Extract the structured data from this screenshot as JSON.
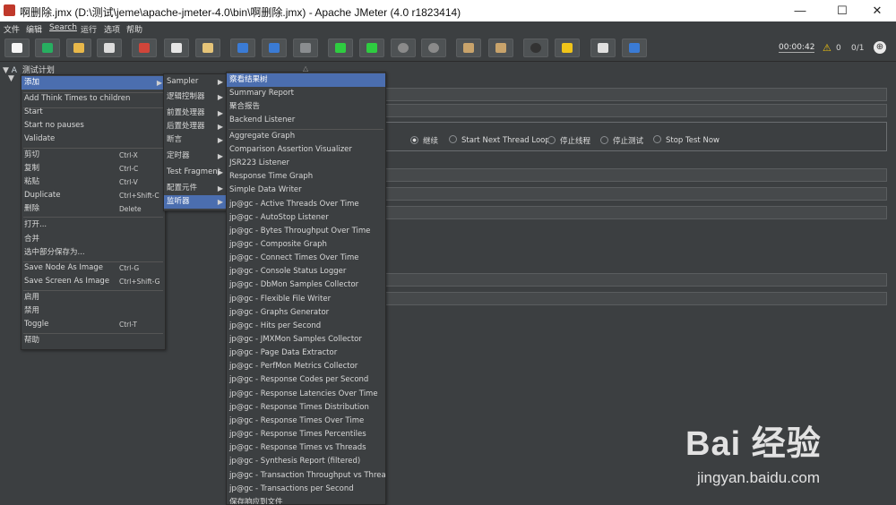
{
  "window": {
    "title": "啊删除.jmx (D:\\测试\\jeme\\apache-jmeter-4.0\\bin\\啊删除.jmx) - Apache JMeter (4.0 r1823414)",
    "minimize": "—",
    "maximize": "☐",
    "close": "✕"
  },
  "menubar": [
    "文件",
    "编辑",
    "Search",
    "运行",
    "选项",
    "帮助"
  ],
  "toolbar": {
    "icons": [
      "new-icon",
      "templates-icon",
      "open-icon",
      "save-icon",
      "cut-icon",
      "copy-icon",
      "paste-icon",
      "expand-icon",
      "collapse-icon",
      "toggle-icon",
      "start-icon",
      "start-no-pauses-icon",
      "stop-icon",
      "shutdown-icon",
      "clear-icon",
      "clear-all-icon",
      "search-icon",
      "reset-search-icon",
      "function-helper-icon",
      "help-icon"
    ],
    "timer": "00:00:42",
    "warning_count": "0",
    "threads": "0/1"
  },
  "tree": {
    "root": "测试计划"
  },
  "thread_group": {
    "on_error_options": [
      "继续",
      "Start Next Thread Loop",
      "停止线程",
      "停止测试",
      "Stop Test Now"
    ],
    "selected": "继续"
  },
  "context_menu": {
    "items": [
      {
        "label": "添加",
        "shortcut": "",
        "submenu": true,
        "selected": true
      },
      {
        "label": "Add Think Times to children",
        "shortcut": ""
      },
      {
        "label": "Start",
        "shortcut": ""
      },
      {
        "label": "Start no pauses",
        "shortcut": ""
      },
      {
        "label": "Validate",
        "shortcut": ""
      },
      {
        "label": "剪切",
        "shortcut": "Ctrl-X"
      },
      {
        "label": "复制",
        "shortcut": "Ctrl-C"
      },
      {
        "label": "粘贴",
        "shortcut": "Ctrl-V"
      },
      {
        "label": "Duplicate",
        "shortcut": "Ctrl+Shift-C"
      },
      {
        "label": "删除",
        "shortcut": "Delete"
      },
      {
        "label": "打开...",
        "shortcut": ""
      },
      {
        "label": "合并",
        "shortcut": ""
      },
      {
        "label": "选中部分保存为...",
        "shortcut": ""
      },
      {
        "label": "Save Node As Image",
        "shortcut": "Ctrl-G"
      },
      {
        "label": "Save Screen As Image",
        "shortcut": "Ctrl+Shift-G"
      },
      {
        "label": "启用",
        "shortcut": ""
      },
      {
        "label": "禁用",
        "shortcut": ""
      },
      {
        "label": "Toggle",
        "shortcut": "Ctrl-T"
      },
      {
        "label": "帮助",
        "shortcut": ""
      }
    ]
  },
  "add_submenu": {
    "items": [
      {
        "label": "Sampler"
      },
      {
        "label": "逻辑控制器"
      },
      {
        "label": "前置处理器"
      },
      {
        "label": "后置处理器"
      },
      {
        "label": "断言"
      },
      {
        "label": "定时器"
      },
      {
        "label": "Test Fragment"
      },
      {
        "label": "配置元件"
      },
      {
        "label": "监听器",
        "selected": true
      }
    ]
  },
  "listener_submenu": {
    "items": [
      "察看结果树",
      "Summary Report",
      "聚合报告",
      "Backend Listener",
      "Aggregate Graph",
      "Comparison Assertion Visualizer",
      "JSR223 Listener",
      "Response Time Graph",
      "Simple Data Writer",
      "jp@gc - Active Threads Over Time",
      "jp@gc - AutoStop Listener",
      "jp@gc - Bytes Throughput Over Time",
      "jp@gc - Composite Graph",
      "jp@gc - Connect Times Over Time",
      "jp@gc - Console Status Logger",
      "jp@gc - DbMon Samples Collector",
      "jp@gc - Flexible File Writer",
      "jp@gc - Graphs Generator",
      "jp@gc - Hits per Second",
      "jp@gc - JMXMon Samples Collector",
      "jp@gc - Page Data Extractor",
      "jp@gc - PerfMon Metrics Collector",
      "jp@gc - Response Codes per Second",
      "jp@gc - Response Latencies Over Time",
      "jp@gc - Response Times Distribution",
      "jp@gc - Response Times Over Time",
      "jp@gc - Response Times Percentiles",
      "jp@gc - Response Times vs Threads",
      "jp@gc - Synthesis Report (filtered)",
      "jp@gc - Transaction Throughput vs Threads",
      "jp@gc - Transactions per Second",
      "保存响应到文件"
    ]
  },
  "watermark": {
    "brand": "Bai 经验",
    "url": "jingyan.baidu.com"
  },
  "colors": {
    "background": "#3c3f41",
    "selection": "#4b6eaf",
    "text": "#d7d7d7"
  }
}
